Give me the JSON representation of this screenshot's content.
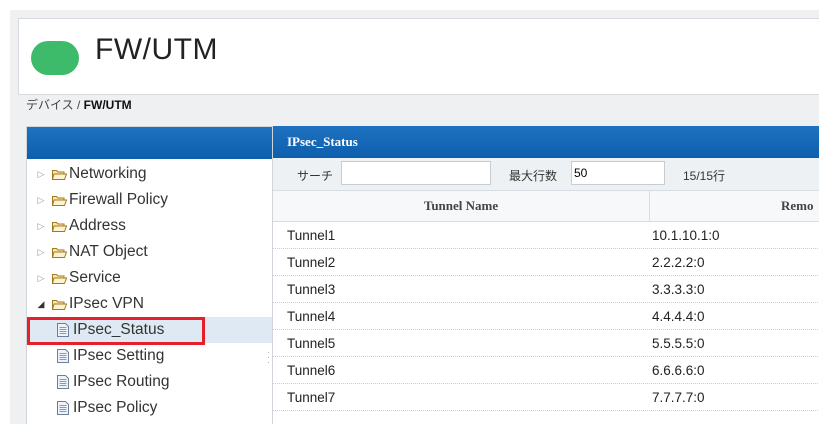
{
  "app": {
    "title": "FW/UTM",
    "logo_color": "#3dba6a"
  },
  "breadcrumb": {
    "parent": "デバイス",
    "separator": " / ",
    "current": "FW/UTM"
  },
  "sidebar": {
    "items": [
      {
        "label": "Networking",
        "type": "folder",
        "expanded": false
      },
      {
        "label": "Firewall Policy",
        "type": "folder",
        "expanded": false
      },
      {
        "label": "Address",
        "type": "folder",
        "expanded": false
      },
      {
        "label": "NAT Object",
        "type": "folder",
        "expanded": false
      },
      {
        "label": "Service",
        "type": "folder",
        "expanded": false
      },
      {
        "label": "IPsec VPN",
        "type": "folder",
        "expanded": true
      },
      {
        "label": "IPsec_Status",
        "type": "file",
        "selected": true
      },
      {
        "label": "IPsec Setting",
        "type": "file"
      },
      {
        "label": "IPsec Routing",
        "type": "file"
      },
      {
        "label": "IPsec Policy",
        "type": "file"
      }
    ]
  },
  "panel": {
    "title": "IPsec_Status",
    "toolbar": {
      "search_label": "サーチ",
      "search_value": "",
      "maxrows_label": "最大行数",
      "maxrows_value": "50",
      "row_count": "15/15行"
    },
    "columns": [
      "Tunnel Name",
      "Remo"
    ],
    "rows": [
      [
        "Tunnel1",
        "10.1.10.1:0"
      ],
      [
        "Tunnel2",
        "2.2.2.2:0"
      ],
      [
        "Tunnel3",
        "3.3.3.3:0"
      ],
      [
        "Tunnel4",
        "4.4.4.4:0"
      ],
      [
        "Tunnel5",
        "5.5.5.5:0"
      ],
      [
        "Tunnel6",
        "6.6.6.6:0"
      ],
      [
        "Tunnel7",
        "7.7.7.7:0"
      ]
    ]
  },
  "colors": {
    "header_blue": "#0d5fae",
    "highlight_red": "#e5202a",
    "selected_row": "#dfe9f3"
  }
}
